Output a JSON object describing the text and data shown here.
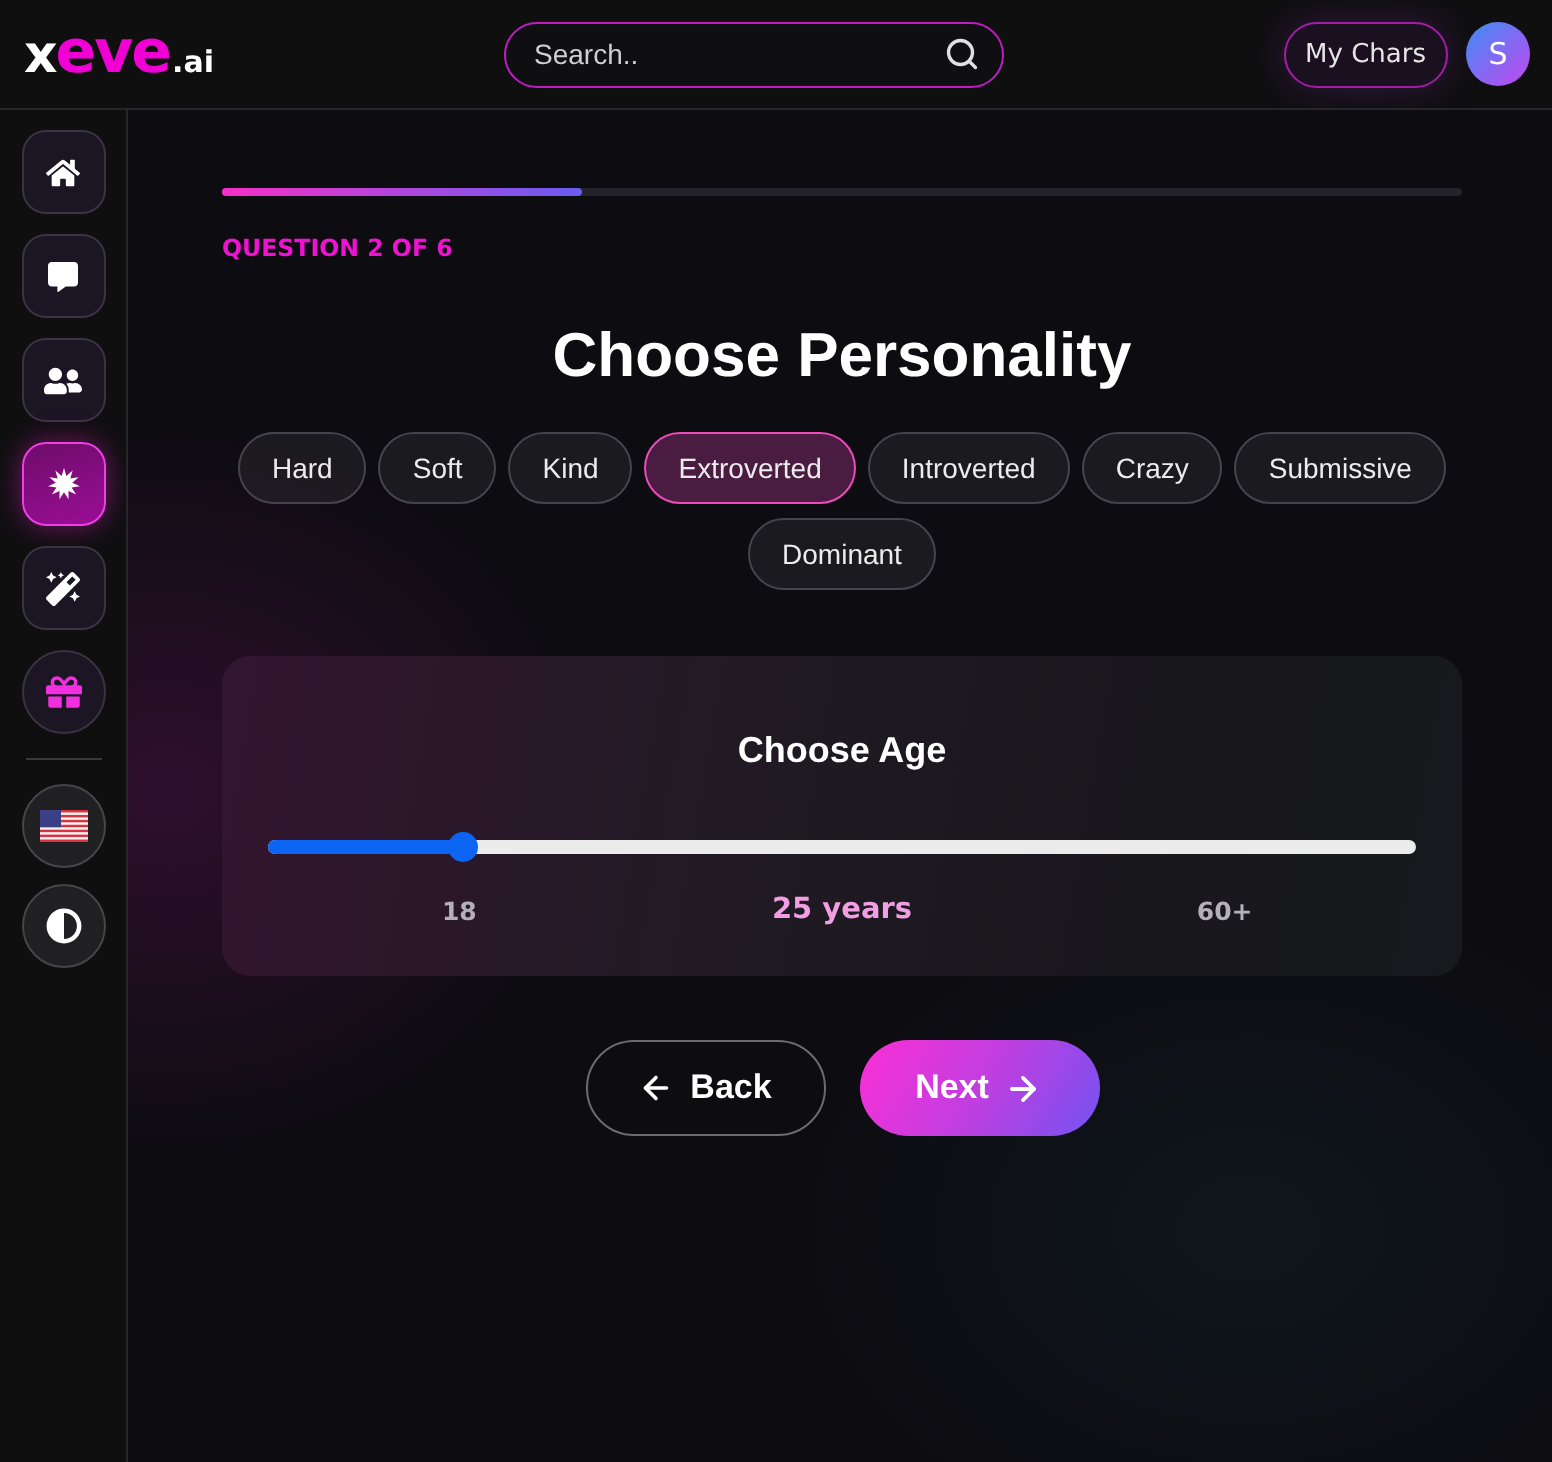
{
  "header": {
    "logo": {
      "lead": "x",
      "accent": "eve",
      "suffix": ".ai"
    },
    "search": {
      "placeholder": "Search.."
    },
    "my_chars_button": "My Chars",
    "avatar": "S"
  },
  "sidebar": {
    "nav": [
      {
        "kind": "home",
        "selected": false
      },
      {
        "kind": "chats",
        "selected": false
      },
      {
        "kind": "characters",
        "selected": false
      },
      {
        "kind": "generate",
        "selected": true
      },
      {
        "kind": "create",
        "selected": false
      },
      {
        "kind": "gift",
        "selected": false
      }
    ],
    "settings": [
      {
        "kind": "language"
      },
      {
        "kind": "theme"
      }
    ]
  },
  "main": {
    "progress": {
      "level": 0.29
    },
    "step_label": "QUESTION 2 OF 6",
    "title": "Choose Personality",
    "options": [
      {
        "label": "Hard",
        "selected": false
      },
      {
        "label": "Soft",
        "selected": false
      },
      {
        "label": "Kind",
        "selected": false
      },
      {
        "label": "Extroverted",
        "selected": true
      },
      {
        "label": "Introverted",
        "selected": false
      },
      {
        "label": "Crazy",
        "selected": false
      },
      {
        "label": "Submissive",
        "selected": false
      },
      {
        "label": "Dominant",
        "selected": false
      }
    ],
    "age": {
      "title": "Choose Age",
      "level": 0.17,
      "min_label": "18",
      "value_label": "25 years",
      "max_label": "60+"
    },
    "buttons": [
      {
        "kind": "back",
        "label": "Back"
      },
      {
        "kind": "next",
        "label": "Next"
      }
    ]
  }
}
